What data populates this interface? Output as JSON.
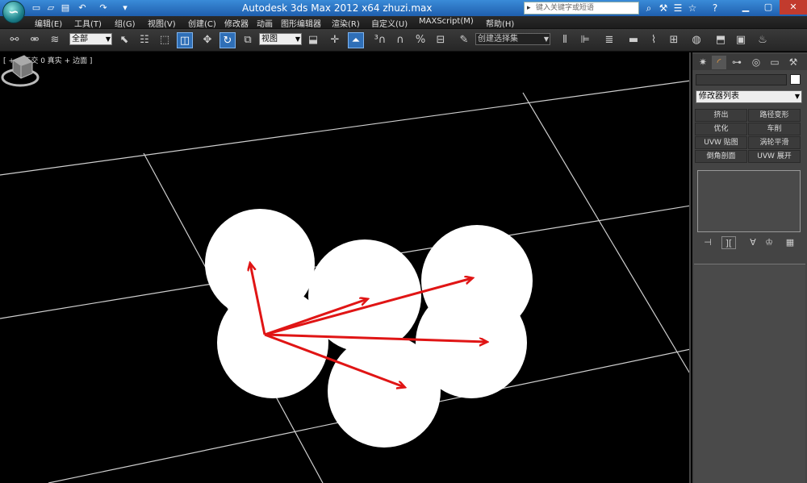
{
  "window": {
    "title": "Autodesk 3ds Max  2012  x64    zhuzi.max",
    "search_placeholder": "键入关键字或短语"
  },
  "menu": [
    {
      "label": "编辑(E)"
    },
    {
      "label": "工具(T)"
    },
    {
      "label": "组(G)"
    },
    {
      "label": "视图(V)"
    },
    {
      "label": "创建(C)"
    },
    {
      "label": "修改器"
    },
    {
      "label": "动画"
    },
    {
      "label": "图形编辑器"
    },
    {
      "label": "渲染(R)"
    },
    {
      "label": "自定义(U)"
    },
    {
      "label": "MAXScript(M)"
    },
    {
      "label": "帮助(H)"
    }
  ],
  "toolbar": {
    "selection_filter": "全部",
    "ref_coord": "视图",
    "named_selection": "创建选择集"
  },
  "viewport": {
    "label": "[ + 0 正交 0 真实 + 边面 ]"
  },
  "command_panel": {
    "modifier_list": "修改器列表",
    "buttons": [
      {
        "label": "挤出"
      },
      {
        "label": "路径变形"
      },
      {
        "label": "优化"
      },
      {
        "label": "车削"
      },
      {
        "label": "UVW 贴图"
      },
      {
        "label": "涡轮平滑"
      },
      {
        "label": "倒角剖面"
      },
      {
        "label": "UVW 展开"
      }
    ]
  },
  "colors": {
    "arrow": "#e01515",
    "circle": "#ffffff",
    "grid": "#cfcfcf",
    "titlebar": "#2a6fc0"
  }
}
